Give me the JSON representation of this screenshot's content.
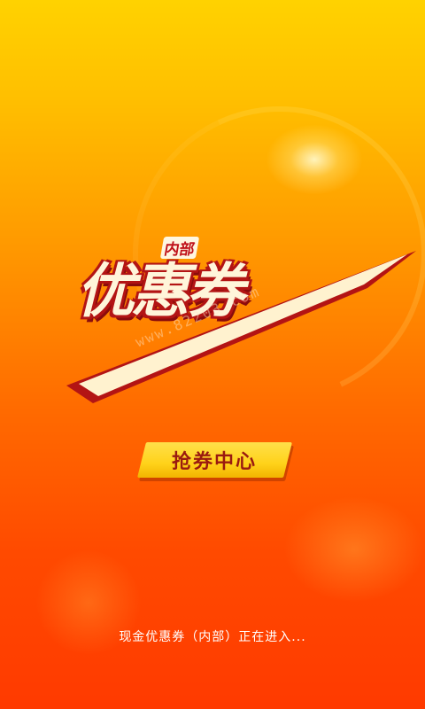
{
  "splash": {
    "logo": {
      "title": "优惠券",
      "tag": "内部",
      "watermark": "www.82203.com"
    },
    "cta_label": "抢券中心",
    "status_text": "现金优惠券（内部）正在进入..."
  },
  "colors": {
    "background_top": "#ffd200",
    "background_bottom": "#ff3a00",
    "logo_outline": "#b31414",
    "cta_fill": "#ffd21a",
    "cta_text": "#9a1a10"
  }
}
